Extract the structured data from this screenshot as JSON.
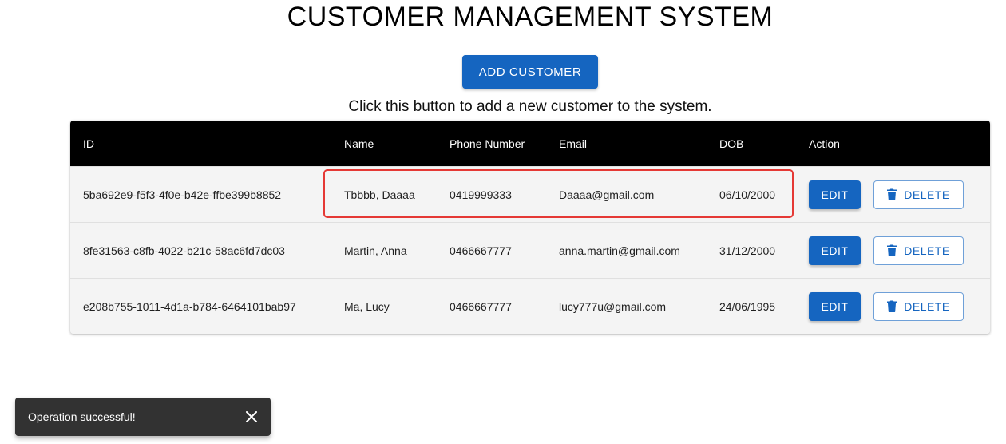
{
  "header": {
    "title": "CUSTOMER MANAGEMENT SYSTEM",
    "add_button_label": "ADD CUSTOMER",
    "hint": "Click this button to add a new customer to the system."
  },
  "table": {
    "columns": [
      "ID",
      "Name",
      "Phone Number",
      "Email",
      "DOB",
      "Action"
    ],
    "rows": [
      {
        "id": "5ba692e9-f5f3-4f0e-b42e-ffbe399b8852",
        "name": "Tbbbb, Daaaa",
        "phone": "0419999333",
        "email": "Daaaa@gmail.com",
        "dob": "06/10/2000",
        "highlighted": true
      },
      {
        "id": "8fe31563-c8fb-4022-b21c-58ac6fd7dc03",
        "name": "Martin, Anna",
        "phone": "0466667777",
        "email": "anna.martin@gmail.com",
        "dob": "31/12/2000",
        "highlighted": false
      },
      {
        "id": "e208b755-1011-4d1a-b784-6464101bab97",
        "name": "Ma, Lucy",
        "phone": "0466667777",
        "email": "lucy777u@gmail.com",
        "dob": "24/06/1995",
        "highlighted": false
      }
    ],
    "edit_label": "EDIT",
    "delete_label": "DELETE",
    "delete_icon": "trash-icon"
  },
  "snackbar": {
    "message": "Operation successful!",
    "close_icon": "close-icon"
  },
  "colors": {
    "primary": "#1565c0",
    "header_bg": "#000000",
    "row_bg": "#f4f4f4",
    "highlight": "#e53935",
    "snackbar_bg": "#323232"
  }
}
